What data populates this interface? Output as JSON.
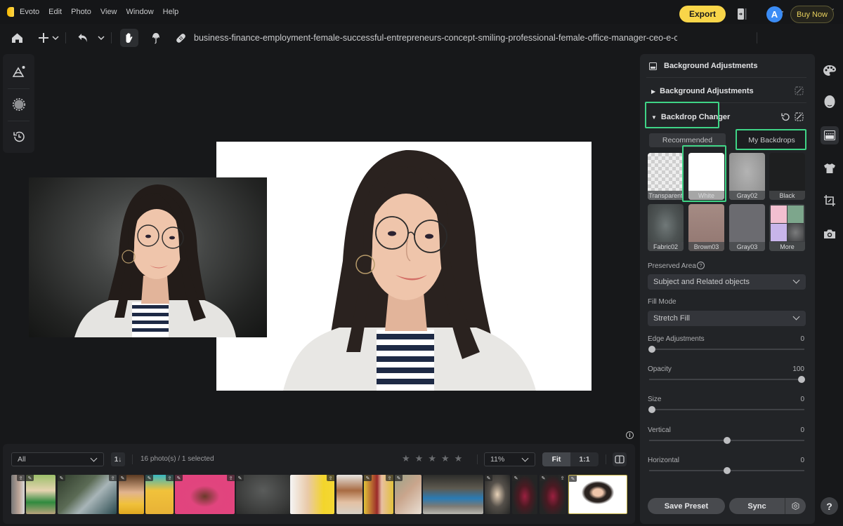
{
  "app": {
    "title": "Evoto",
    "menu": [
      "Evoto",
      "Edit",
      "Photo",
      "View",
      "Window",
      "Help"
    ],
    "window_controls": [
      "minimize-icon",
      "restore-icon",
      "close-icon"
    ]
  },
  "toolbar": {
    "icons": [
      "home-icon",
      "add-icon",
      "chevron-down-icon",
      "undo-icon",
      "chevron-down-icon",
      "hand-icon",
      "brush-icon",
      "bandage-icon"
    ],
    "filename": "business-finance-employment-female-successful-entrepreneurs-concept-smiling-professional-female-office-manager-ceo-e-commer",
    "export_label": "Export",
    "avatar_initial": "A",
    "buy_label": "Buy Now",
    "accent_color": "#f8d549"
  },
  "left_tools": [
    "landscape-adjust-icon",
    "mask-icon",
    "history-icon"
  ],
  "canvas": {
    "info_label": "i"
  },
  "filmstrip": {
    "filter_value": "All",
    "sort_label": "1↓",
    "photo_count": "16 photo(s) / 1 selected",
    "rating_stars": 5,
    "rating_value": 0,
    "zoom_value": "11%",
    "fit_label": "Fit",
    "one_to_one_label": "1:1",
    "thumbnails": [
      {
        "desc": "woman profile gray",
        "badge_right": "upload"
      },
      {
        "desc": "two kids outdoors",
        "badge_left": "edit"
      },
      {
        "desc": "man sitting by window",
        "badge_left": "edit",
        "badge_right": "upload"
      },
      {
        "desc": "man with banana",
        "badge_left": "edit"
      },
      {
        "desc": "woman yellow glasses",
        "badge_left": "edit",
        "badge_right": "upload"
      },
      {
        "desc": "girl pink background",
        "badge_left": "edit",
        "badge_right": "upload"
      },
      {
        "desc": "gray texture",
        "badge_left": "edit"
      },
      {
        "desc": "woman yellow background",
        "badge_right": "upload"
      },
      {
        "desc": "woman with bangs"
      },
      {
        "desc": "redhead yellow background",
        "badge_left": "edit",
        "badge_right": "upload"
      },
      {
        "desc": "girl floral"
      },
      {
        "desc": "blue sports car",
        "badge_left": "edit"
      },
      {
        "desc": "blonde woman dark",
        "badge_left": "edit"
      },
      {
        "desc": "man red shirt",
        "badge_left": "edit",
        "badge_right": "upload"
      },
      {
        "desc": "man red shirt copy",
        "badge_left": "edit"
      },
      {
        "desc": "woman glasses white background",
        "badge_left": "edit",
        "selected": true
      }
    ]
  },
  "right_panel": {
    "header_title": "Background Adjustments",
    "sections": [
      {
        "label": "Background Adjustments",
        "expanded": false
      },
      {
        "label": "Backdrop Changer",
        "expanded": true
      }
    ],
    "tabs": [
      {
        "label": "Recommended",
        "active": false
      },
      {
        "label": "My Backdrops",
        "active": true
      }
    ],
    "backdrops": [
      {
        "label": "Transparent",
        "color": "checker"
      },
      {
        "label": "White",
        "color": "#ffffff",
        "selected": true
      },
      {
        "label": "Gray02",
        "color": "#9b9b9b"
      },
      {
        "label": "Black",
        "color": "#1e1e1e"
      },
      {
        "label": "Fabric02",
        "color": "#555a5a"
      },
      {
        "label": "Brown03",
        "color": "#9e8680"
      },
      {
        "label": "Gray03",
        "color": "#6c6c70"
      },
      {
        "label": "More",
        "color": "grid"
      }
    ],
    "preserved_area": {
      "label": "Preserved Area",
      "value": "Subject and Related objects"
    },
    "fill_mode": {
      "label": "Fill Mode",
      "value": "Stretch Fill"
    },
    "sliders": [
      {
        "label": "Edge Adjustments",
        "value": "0",
        "fraction": 0
      },
      {
        "label": "Opacity",
        "value": "100",
        "fraction": 1
      },
      {
        "label": "Size",
        "value": "0",
        "fraction": 0
      },
      {
        "label": "Vertical",
        "value": "0",
        "fraction": 0.5
      },
      {
        "label": "Horizontal",
        "value": "0",
        "fraction": 0.5
      }
    ],
    "save_preset_label": "Save Preset",
    "sync_label": "Sync",
    "help_label": "?",
    "highlight_color": "#3fd486"
  },
  "right_rail": [
    "palette-icon",
    "face-icon",
    "background-icon",
    "clothing-icon",
    "crop-icon",
    "camera-icon"
  ]
}
